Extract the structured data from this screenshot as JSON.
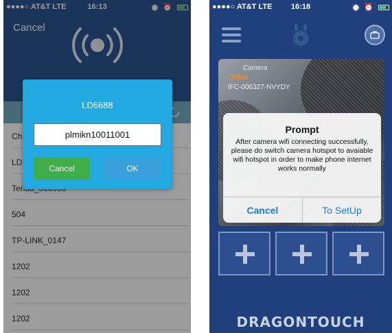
{
  "phone1": {
    "status": {
      "carrier": "AT&T",
      "network": "LTE",
      "time": "16:13"
    },
    "header": {
      "cancel_label": "Cancel",
      "signal_icon": "wireless-signal-icon"
    },
    "wifi_list": [
      "Ch",
      "LD",
      "Tenda_000000",
      "504",
      "TP-LINK_0147",
      "1202",
      "1202",
      "1202"
    ],
    "dialog": {
      "title": "LD6688",
      "password": "plmikn10011001",
      "cancel_label": "Cancel",
      "ok_label": "OK"
    }
  },
  "phone2": {
    "status": {
      "carrier": "AT&T",
      "network": "LTE",
      "time": "16:18"
    },
    "preview": {
      "camera_name": "Camera",
      "status": "Online",
      "camera_id": "IFC-006327-NVYDY"
    },
    "dialog": {
      "title": "Prompt",
      "message": "After camera wifi connecting successfully, please do switch camera hotspot to avaiable wifi hotspot in order to make phone internet works normally",
      "cancel_label": "Cancel",
      "setup_label": "To SetUp"
    },
    "brand": "DRAGONTOUCH"
  },
  "colors": {
    "header_blue": "#1f4e8c",
    "dialog_blue": "#23a9e1",
    "cancel_green": "#3fae49",
    "ok_blue": "#3aa0dc",
    "app_navy": "#1f3f7d",
    "ios_link": "#1a7bd6",
    "online_orange": "#ff8c1a"
  }
}
